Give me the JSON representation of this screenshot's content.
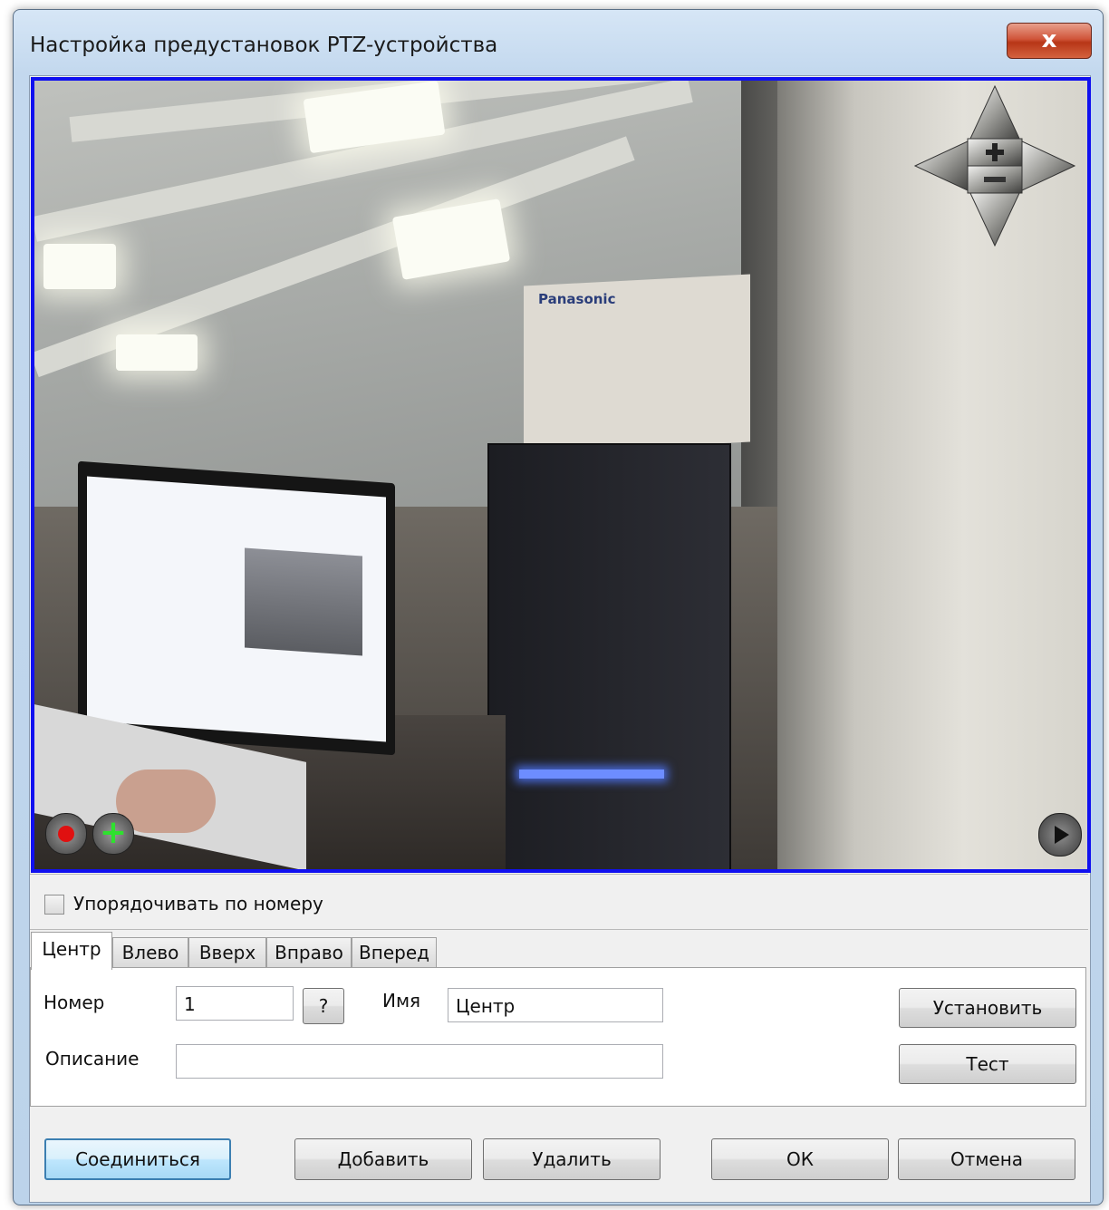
{
  "window": {
    "title": "Настройка предустановок PTZ-устройства",
    "close_label": "x"
  },
  "video": {
    "camera_brand_text": "Panasonic",
    "ptz_controls": [
      "arrow-up-icon",
      "arrow-down-icon",
      "arrow-left-icon",
      "arrow-right-icon",
      "zoom-in-icon",
      "zoom-out-icon"
    ],
    "record_icon": "record-icon",
    "add_preset_symbol": "+",
    "play_icon": "play-icon",
    "border_color": "#1010f0"
  },
  "sort": {
    "label": "Упорядочивать по номеру",
    "checked": false
  },
  "tabs": [
    {
      "label": "Центр",
      "active": true
    },
    {
      "label": "Влево",
      "active": false
    },
    {
      "label": "Вверх",
      "active": false
    },
    {
      "label": "Вправо",
      "active": false
    },
    {
      "label": "Вперед",
      "active": false
    }
  ],
  "form": {
    "number_label": "Номер",
    "number_value": "1",
    "help_button_label": "?",
    "name_label": "Имя",
    "name_value": "Центр",
    "description_label": "Описание",
    "description_value": "",
    "set_button_label": "Установить",
    "test_button_label": "Тест"
  },
  "footer": {
    "connect_label": "Соединиться",
    "add_label": "Добавить",
    "delete_label": "Удалить",
    "ok_label": "ОК",
    "cancel_label": "Отмена"
  }
}
